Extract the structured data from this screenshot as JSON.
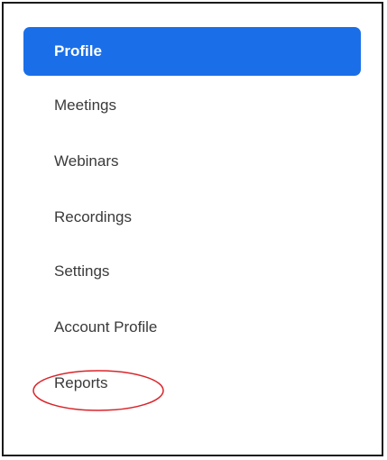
{
  "sidebar": {
    "items": [
      {
        "label": "Profile",
        "active": true
      },
      {
        "label": "Meetings",
        "active": false
      },
      {
        "label": "Webinars",
        "active": false
      },
      {
        "label": "Recordings",
        "active": false
      },
      {
        "label": "Settings",
        "active": false
      },
      {
        "label": "Account Profile",
        "active": false
      },
      {
        "label": "Reports",
        "active": false
      }
    ],
    "active_color": "#1a6fe8",
    "text_color": "#3a3a3a"
  },
  "annotation": {
    "shape": "ellipse",
    "color": "#d9252b",
    "target": "Reports"
  }
}
